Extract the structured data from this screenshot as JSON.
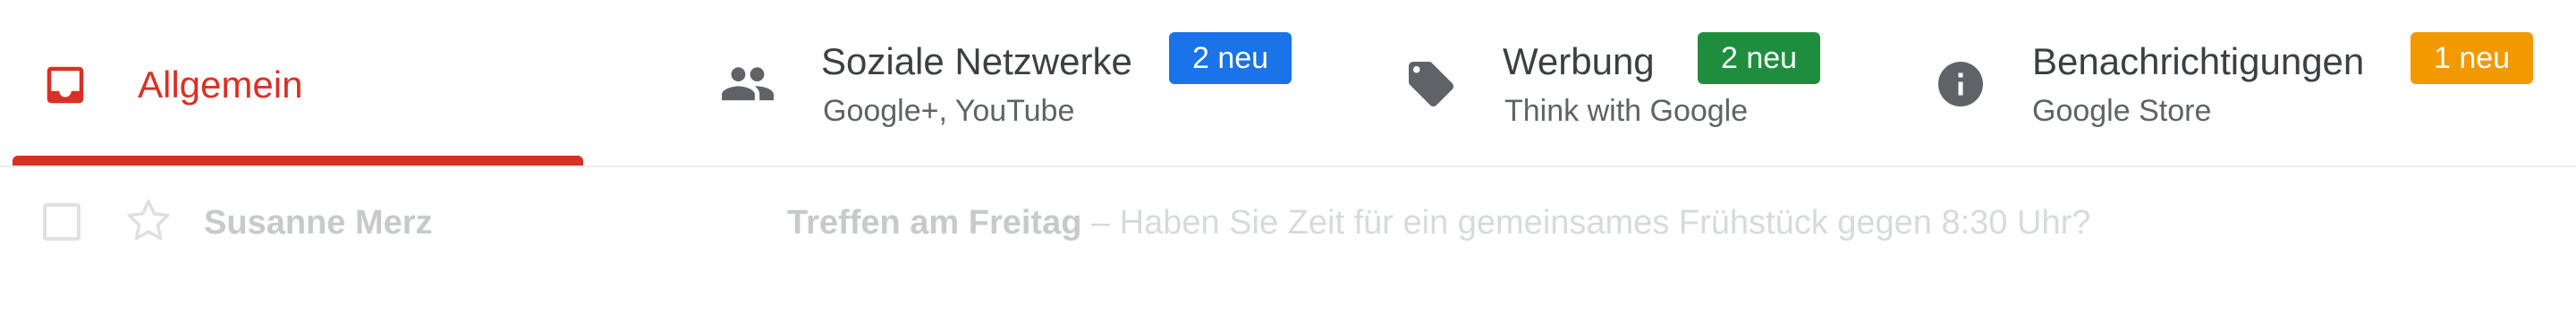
{
  "colors": {
    "accent_red": "#d93025",
    "badge_blue": "#1a73e8",
    "badge_green": "#1e8e3e",
    "badge_orange": "#f29900",
    "icon_gray": "#5f6368"
  },
  "tabs": [
    {
      "label": "Allgemein",
      "icon": "inbox-icon",
      "active": true
    },
    {
      "label": "Soziale Netzwerke",
      "subtitle": "Google+, YouTube",
      "badge": "2 neu",
      "icon": "people-icon"
    },
    {
      "label": "Werbung",
      "subtitle": "Think with Google",
      "badge": "2 neu",
      "icon": "tag-icon"
    },
    {
      "label": "Benachrichtigungen",
      "subtitle": "Google Store",
      "badge": "1 neu",
      "icon": "info-icon"
    }
  ],
  "email": {
    "sender": "Susanne Merz",
    "subject": "Treffen am Freitag",
    "separator": " – ",
    "snippet": "Haben Sie Zeit für ein gemeinsames Frühstück gegen 8:30 Uhr?"
  }
}
